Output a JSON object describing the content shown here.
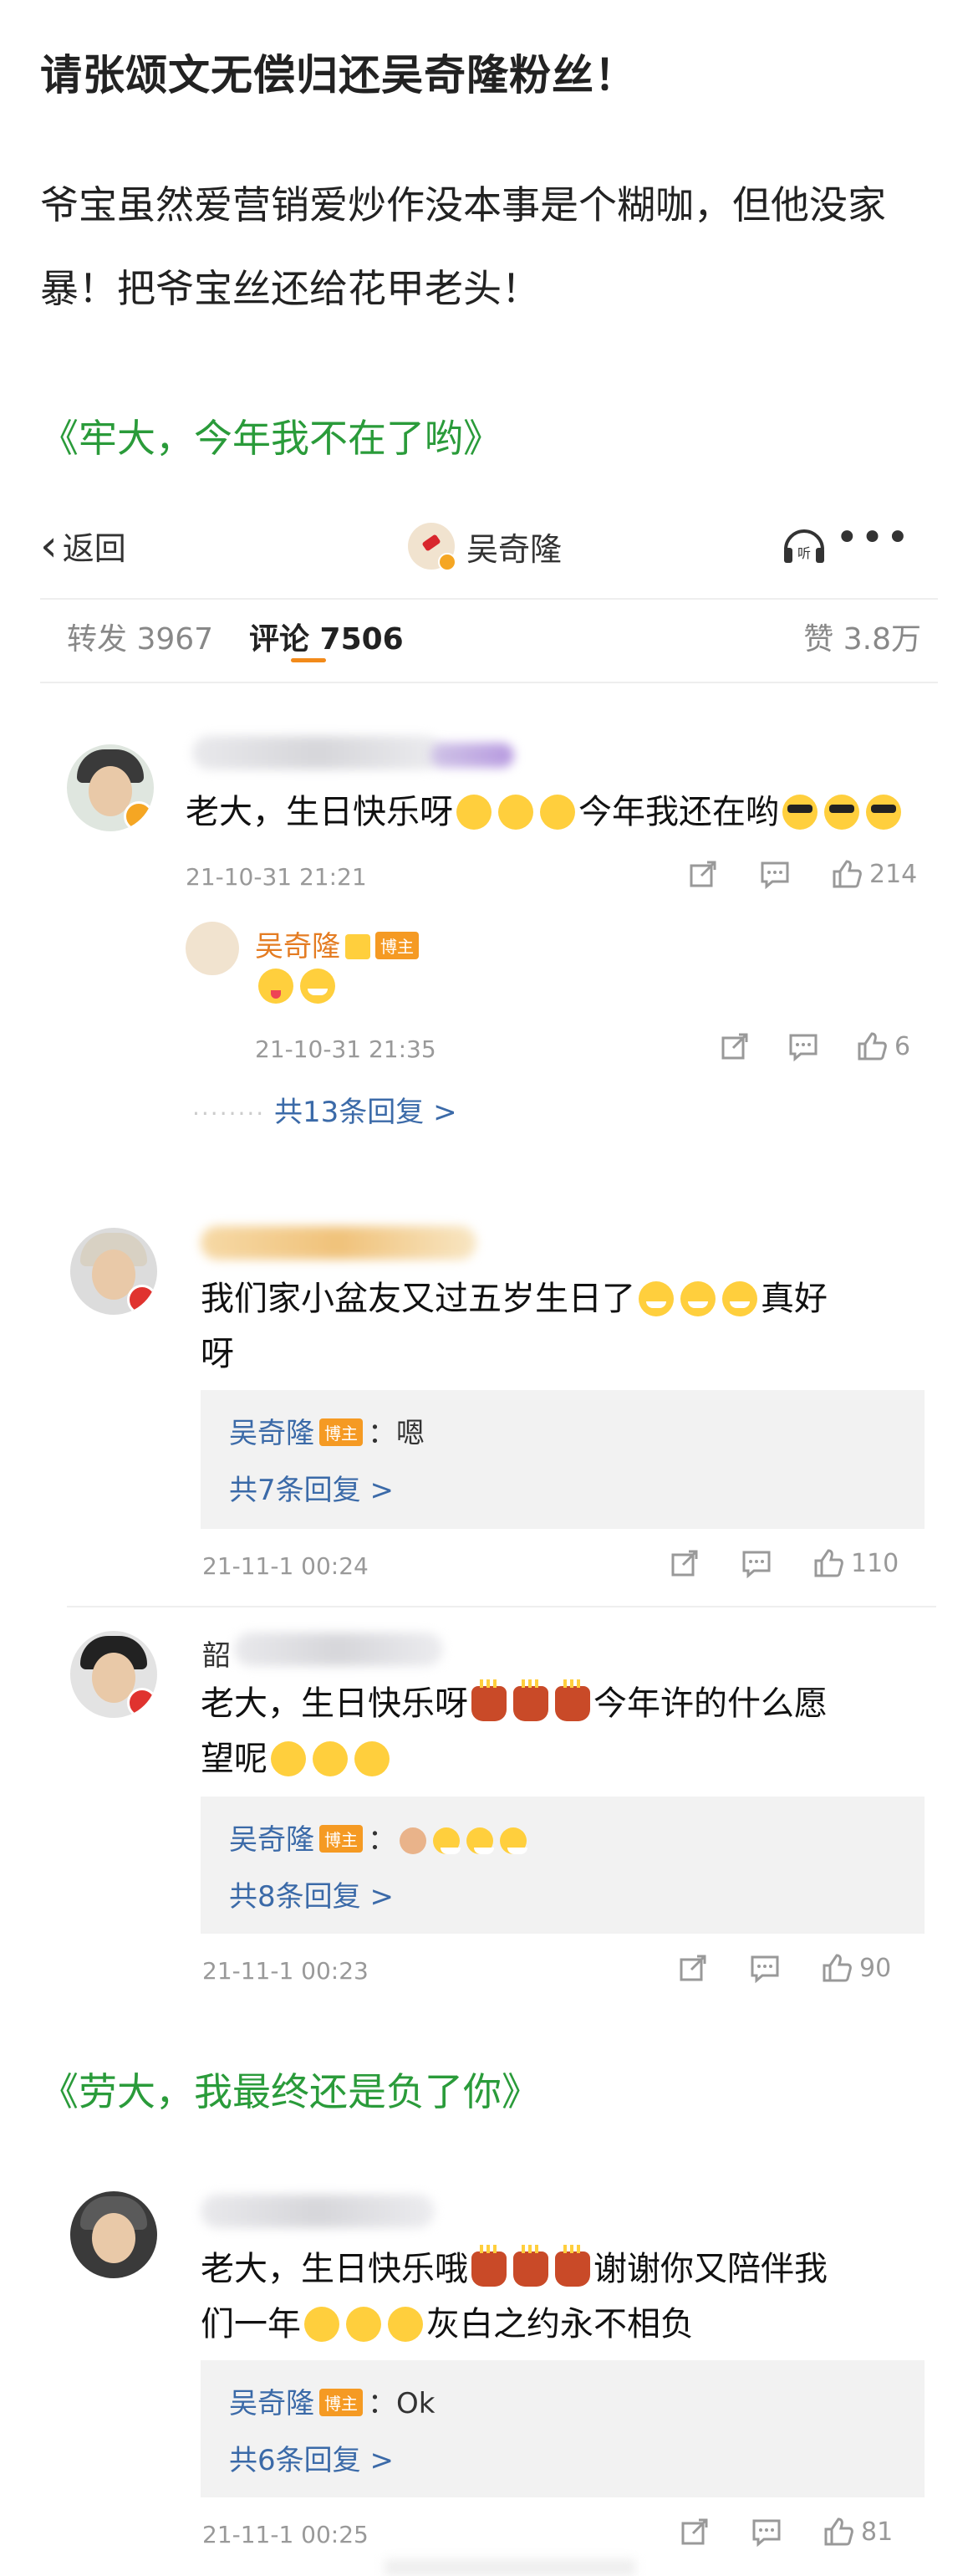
{
  "post": {
    "title": "请张颂文无偿归还吴奇隆粉丝！",
    "body": "爷宝虽然爱营销爱炒作没本事是个糊咖，但他没家暴！把爷宝丝还给花甲老头！",
    "quote1": "《牢大，今年我不在了哟》",
    "quote2": "《劳大，我最终还是负了你》"
  },
  "topbar": {
    "back_label": "返回",
    "user_name": "吴奇隆"
  },
  "tabs": {
    "repost": "转发 3967",
    "comments": "评论 7506",
    "likes": "赞 3.8万"
  },
  "comments": [
    {
      "text": "老大，生日快乐呀",
      "text_tail": "今年我还在哟",
      "time": "21-10-31 21:21",
      "likes": "214",
      "reply": {
        "name": "吴奇隆",
        "badge": "博主",
        "time": "21-10-31 21:35",
        "likes": "6"
      },
      "more_replies": "共13条回复 >"
    },
    {
      "text": "我们家小盆友又过五岁生日了",
      "text_tail": "真好",
      "text_line2": "呀",
      "reply": {
        "name": "吴奇隆",
        "badge": "博主",
        "content": "：嗯"
      },
      "more_replies": "共7条回复 >",
      "time": "21-11-1 00:24",
      "likes": "110"
    },
    {
      "name_char": "韶",
      "text": "老大，生日快乐呀",
      "text_tail": "今年许的什么愿",
      "text_line2": "望呢",
      "reply": {
        "name": "吴奇隆",
        "badge": "博主",
        "content": "："
      },
      "more_replies": "共8条回复 >",
      "time": "21-11-1 00:23",
      "likes": "90"
    },
    {
      "text": "老大，生日快乐哦",
      "text_tail": "谢谢你又陪伴我",
      "text_line2": "们一年",
      "text_line2_tail": "灰白之约永不相负",
      "reply": {
        "name": "吴奇隆",
        "badge": "博主",
        "content": "：Ok"
      },
      "more_replies": "共6条回复 >",
      "time": "21-11-1 00:25",
      "likes": "81"
    }
  ],
  "colors": {
    "green": "#2a9b3a",
    "link_blue": "#3b6aa8",
    "orange": "#f28a1a",
    "badge": "#f59a23"
  }
}
